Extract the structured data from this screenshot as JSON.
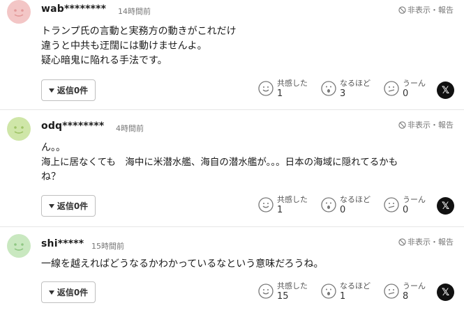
{
  "colors": {
    "avatar_pink": "#f3c6c6",
    "avatar_green": "#cfe6a8",
    "avatar_lightgreen": "#c9e8c0",
    "x_button": "#111111"
  },
  "comments": [
    {
      "user": "wab********",
      "time": "14時間前",
      "report": "非表示・報告",
      "lines": [
        "トランプ氏の言動と実務方の動きがこれだけ",
        "違うと中共も迂闊には動けませんよ。",
        "疑心暗鬼に陥れる手法です。"
      ],
      "reply_label": "返信0件",
      "reactions": {
        "empathy_label": "共感した",
        "empathy_count": "1",
        "insight_label": "なるほど",
        "insight_count": "3",
        "hmm_label": "うーん",
        "hmm_count": "0"
      },
      "avatar_icon": "smiley-face-icon",
      "share_icon": "x-logo-icon"
    },
    {
      "user": "odq********",
      "time": "4時間前",
      "report": "非表示・報告",
      "lines": [
        "ん。。",
        "海上に居なくても　海中に米潜水艦、海自の潜水艦が。。。日本の海域に隠れてるかも",
        "ね？"
      ],
      "reply_label": "返信0件",
      "reactions": {
        "empathy_label": "共感した",
        "empathy_count": "1",
        "insight_label": "なるほど",
        "insight_count": "0",
        "hmm_label": "うーん",
        "hmm_count": "0"
      },
      "avatar_icon": "smiley-face-icon",
      "share_icon": "x-logo-icon"
    },
    {
      "user": "shi*****",
      "time": "15時間前",
      "report": "非表示・報告",
      "lines": [
        "一線を越えればどうなるかわかっているなという意味だろうね。"
      ],
      "reply_label": "返信0件",
      "reactions": {
        "empathy_label": "共感した",
        "empathy_count": "15",
        "insight_label": "なるほど",
        "insight_count": "1",
        "hmm_label": "うーん",
        "hmm_count": "8"
      },
      "avatar_icon": "smiley-face-icon",
      "share_icon": "x-logo-icon"
    }
  ]
}
